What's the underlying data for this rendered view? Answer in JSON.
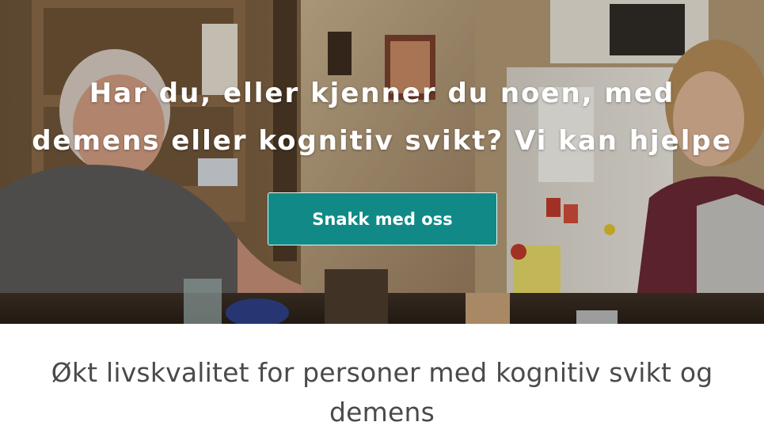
{
  "hero": {
    "heading_line1": "Har du, eller kjenner du noen, med",
    "heading_line2": "demens eller kognitiv svikt? Vi kan hjelpe",
    "cta_label": "Snakk med oss",
    "photo_alt": "",
    "colors": {
      "button": "#118a87",
      "heading": "#ffffff"
    }
  },
  "section": {
    "title_line1": "Økt livskvalitet for personer med kognitiv svikt og",
    "title_line2": "demens",
    "color": "#4a4a4a"
  }
}
